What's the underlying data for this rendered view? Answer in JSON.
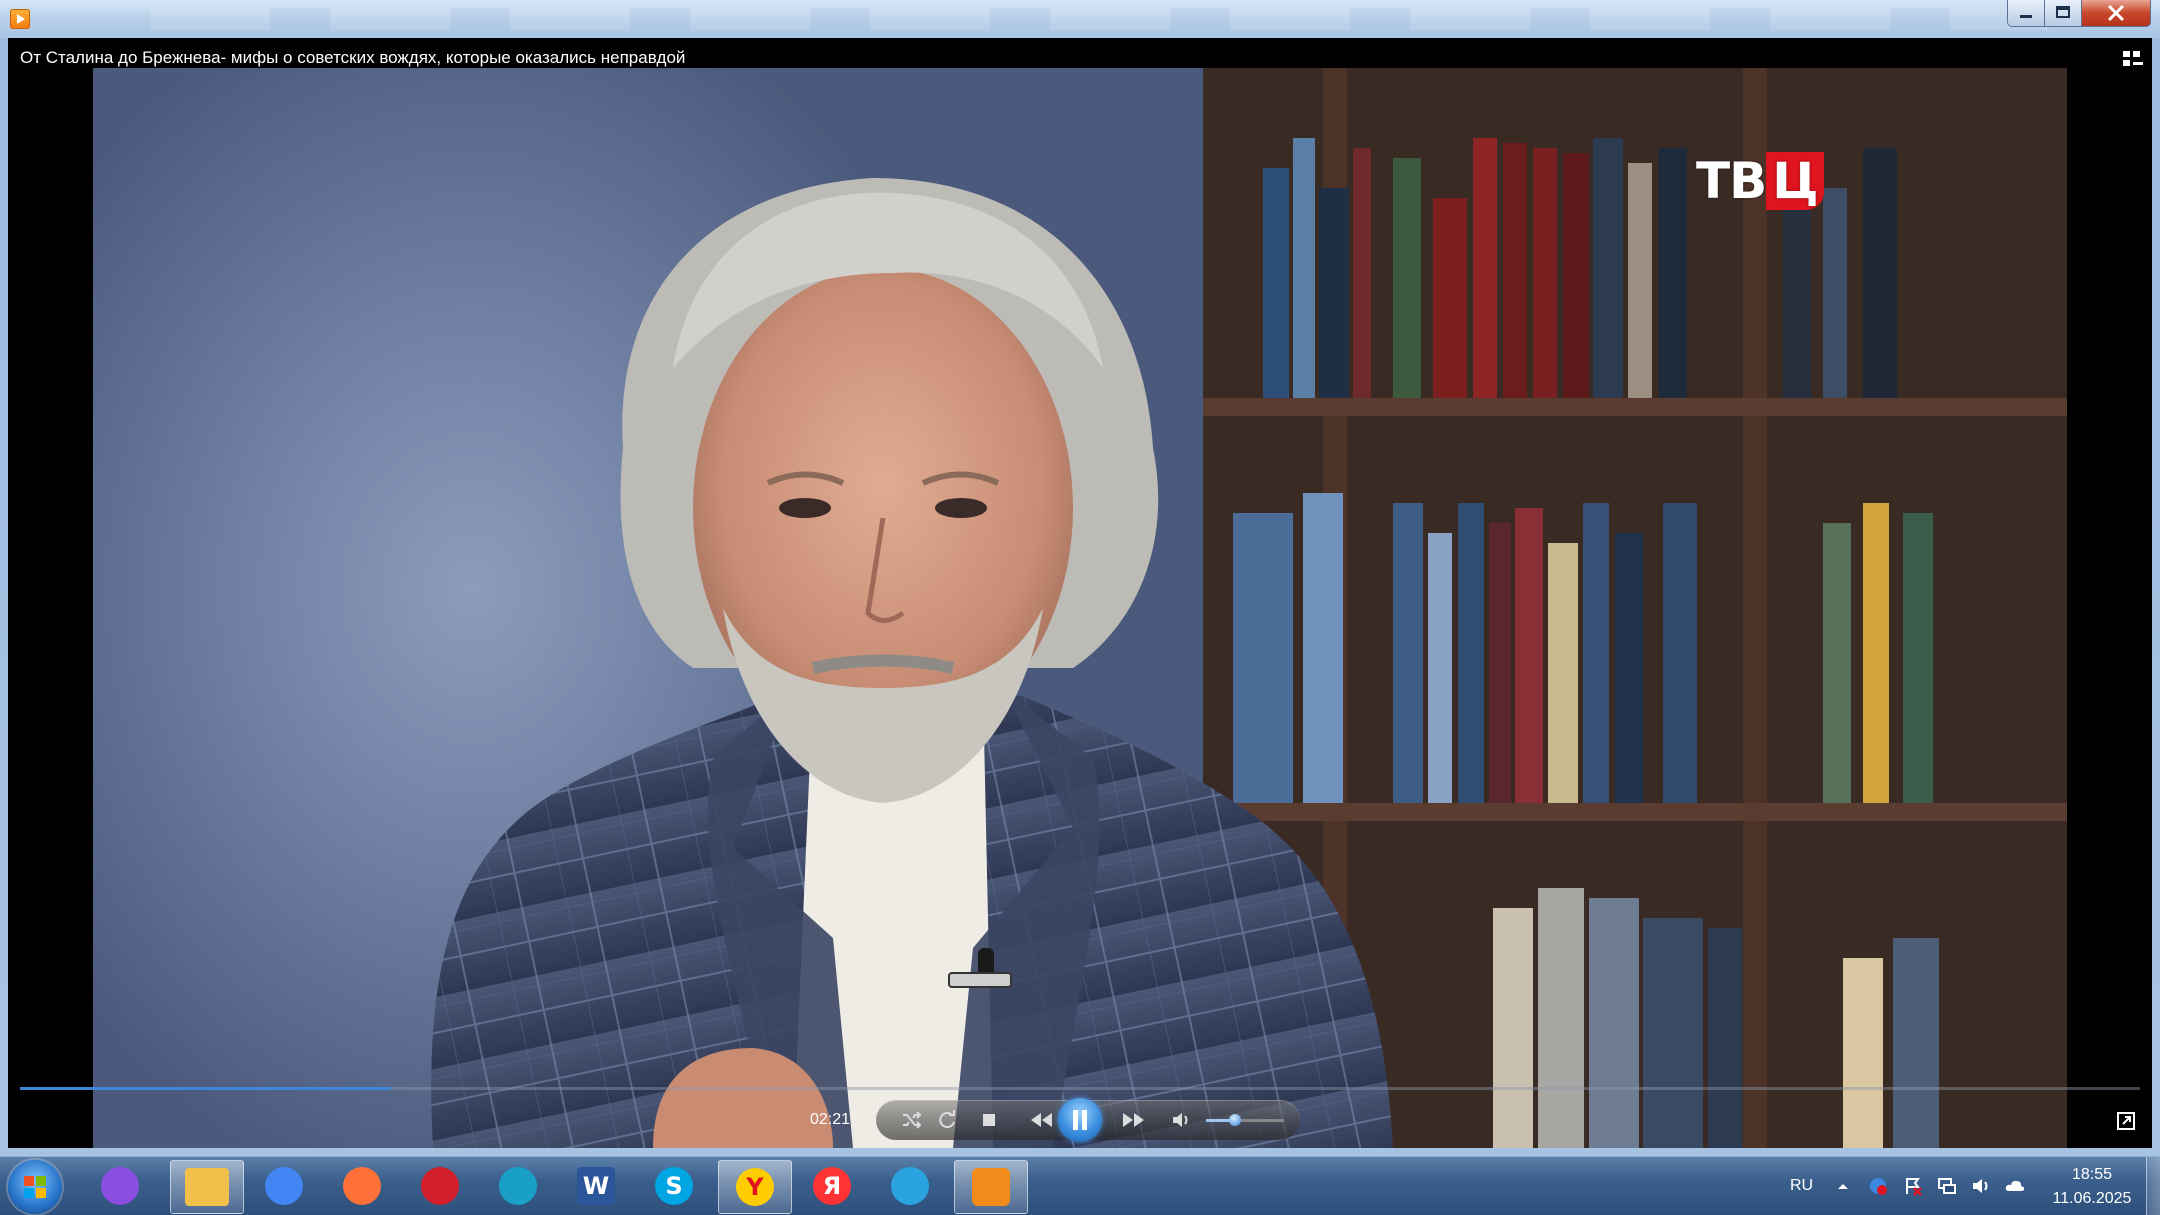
{
  "window": {
    "title_icon": "media-player-icon",
    "controls": {
      "minimize": "minimize-icon",
      "maximize": "maximize-icon",
      "close": "close-icon"
    }
  },
  "video": {
    "title": "От Сталина до Брежнева- мифы о советских вождях, которые оказались неправдой",
    "channel_logo_left": "ТВ",
    "channel_logo_accent": "Ц",
    "logo_accent_color": "#e0141e"
  },
  "player": {
    "current_time": "02:21",
    "progress_fraction": 0.175,
    "volume_fraction": 0.32,
    "state": "playing",
    "accent_color": "#3f86d9",
    "buttons": [
      "shuffle-icon",
      "repeat-icon",
      "stop-icon",
      "rewind-icon",
      "pause-icon",
      "fast-forward-icon",
      "volume-icon",
      "fullscreen-icon",
      "playlist-icon"
    ]
  },
  "taskbar": {
    "apps": [
      {
        "name": "alice",
        "icon": "alice-icon",
        "color": "#8a4fe0"
      },
      {
        "name": "explorer",
        "icon": "folder-icon",
        "color": "#f0c04a",
        "active": true
      },
      {
        "name": "chrome",
        "icon": "chrome-icon",
        "color": "#4285f4"
      },
      {
        "name": "firefox",
        "icon": "firefox-icon",
        "color": "#ff7139"
      },
      {
        "name": "opera",
        "icon": "opera-icon",
        "color": "#d21f2b"
      },
      {
        "name": "edge",
        "icon": "edge-icon",
        "color": "#1aa0c8"
      },
      {
        "name": "word",
        "icon": "word-icon",
        "color": "#2b579a",
        "glyph": "W"
      },
      {
        "name": "skype",
        "icon": "skype-icon",
        "color": "#00a5e3",
        "glyph": "S"
      },
      {
        "name": "yandex-browser",
        "icon": "yandex-browser-icon",
        "color": "#ffcc00",
        "glyph": "Y",
        "active": true
      },
      {
        "name": "yandex",
        "icon": "yandex-icon",
        "color": "#f33",
        "glyph": "Я"
      },
      {
        "name": "telegram",
        "icon": "telegram-icon",
        "color": "#2aa3e0"
      },
      {
        "name": "media-player",
        "icon": "media-player-icon",
        "color": "#f28a1c",
        "active": true
      }
    ],
    "tray": {
      "language": "RU",
      "icons": [
        "show-hidden-icon",
        "yandex-disk-icon",
        "action-center-flag-icon",
        "network-icon",
        "speaker-icon",
        "cloud-icon"
      ],
      "time": "18:55",
      "date": "11.06.2025"
    }
  }
}
